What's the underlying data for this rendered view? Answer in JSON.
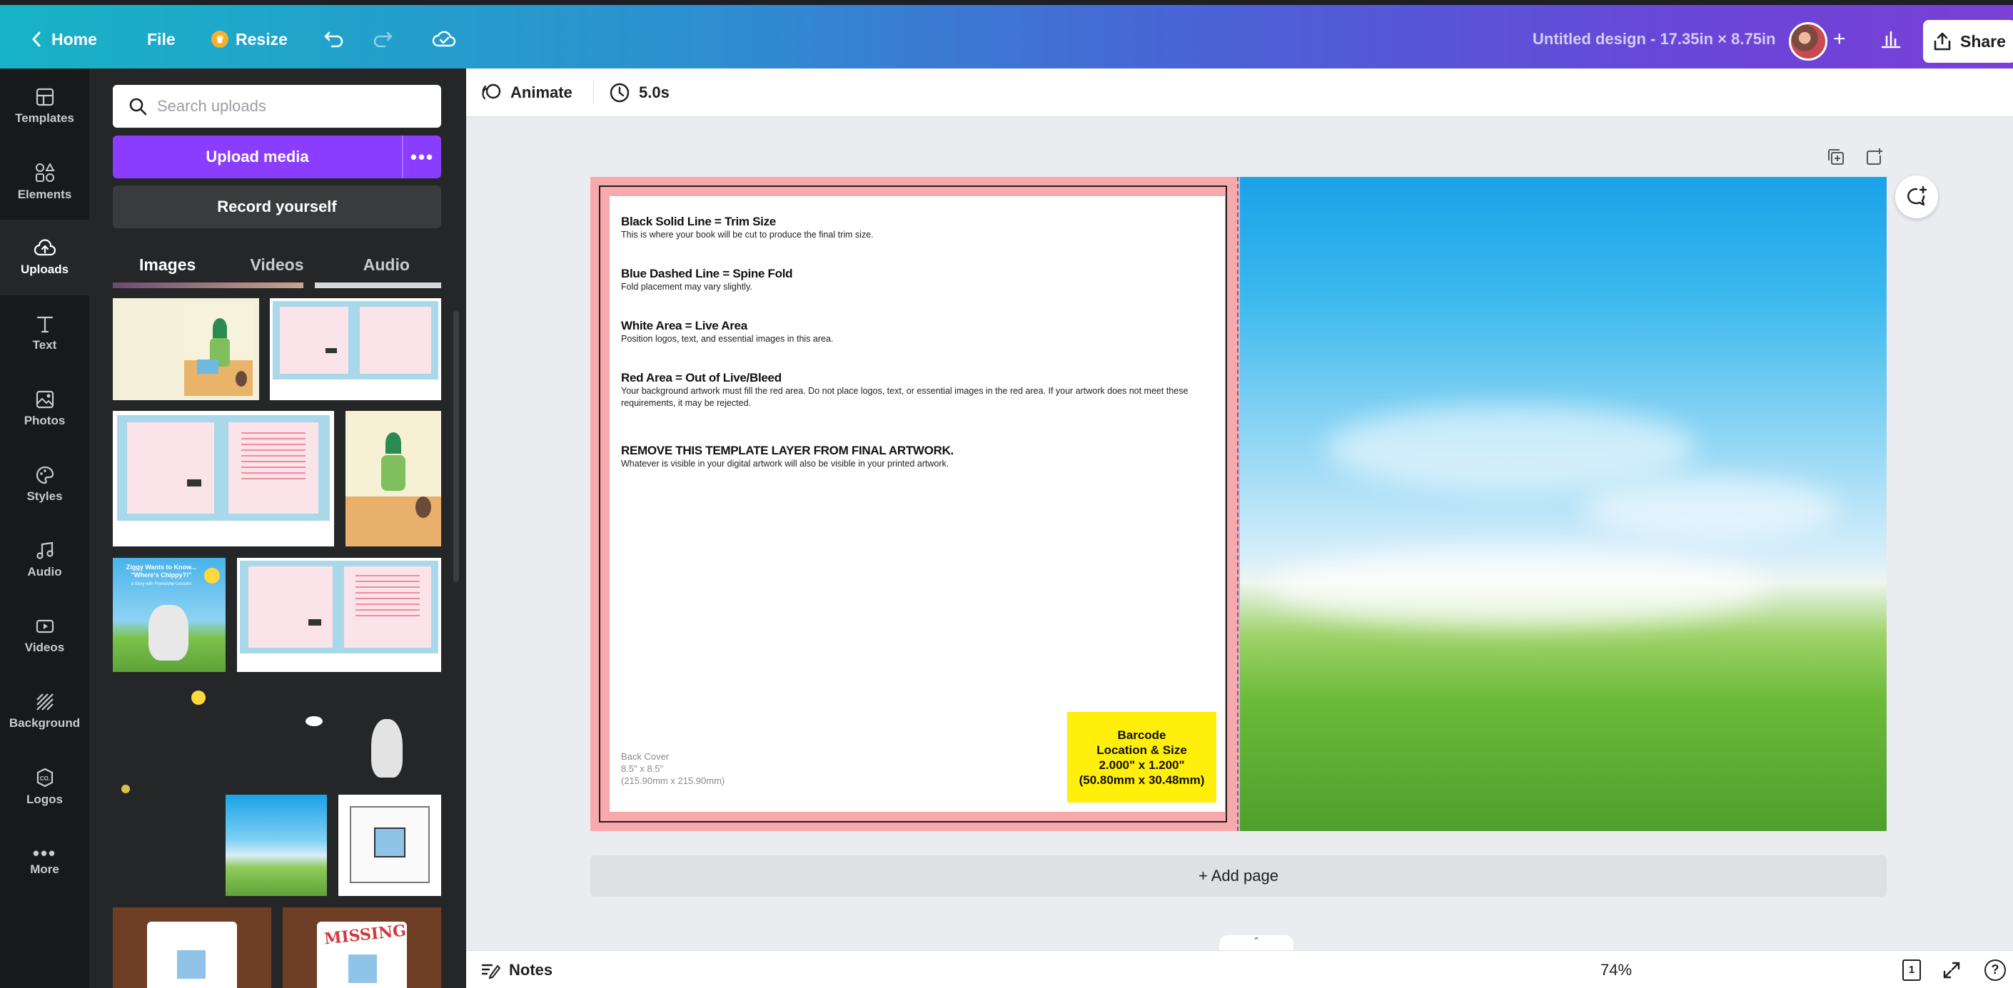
{
  "topbar": {
    "home_label": "Home",
    "file_label": "File",
    "resize_label": "Resize",
    "title": "Untitled design - 17.35in × 8.75in",
    "share_label": "Share"
  },
  "rail": {
    "items": [
      {
        "label": "Templates",
        "icon": "templates-icon"
      },
      {
        "label": "Elements",
        "icon": "elements-icon"
      },
      {
        "label": "Uploads",
        "icon": "uploads-icon"
      },
      {
        "label": "Text",
        "icon": "text-icon"
      },
      {
        "label": "Photos",
        "icon": "photos-icon"
      },
      {
        "label": "Styles",
        "icon": "styles-icon"
      },
      {
        "label": "Audio",
        "icon": "audio-icon"
      },
      {
        "label": "Videos",
        "icon": "videos-icon"
      },
      {
        "label": "Background",
        "icon": "background-icon"
      },
      {
        "label": "Logos",
        "icon": "logos-icon"
      },
      {
        "label": "More",
        "icon": "more-icon"
      }
    ],
    "active": "Uploads"
  },
  "panel": {
    "search_placeholder": "Search uploads",
    "upload_label": "Upload media",
    "record_label": "Record yourself",
    "tabs": [
      "Images",
      "Videos",
      "Audio"
    ],
    "active_tab": "Images",
    "thumb_texts": {
      "ziggy_title": "Ziggy Wants to Know... \"Where's Chippy?!\"",
      "ziggy_sub": "a Story with Friendship Lessons",
      "missing": "MISSING"
    }
  },
  "canvas": {
    "animate_label": "Animate",
    "duration_label": "5.0s",
    "template": {
      "h1": "Black Solid Line = Trim Size",
      "p1": "This is where your book will be cut to produce the final trim size.",
      "h2": "Blue Dashed Line = Spine Fold",
      "p2": "Fold placement may vary slightly.",
      "h3": "White Area = Live Area",
      "p3": "Position logos, text, and essential images in this area.",
      "h4": "Red Area = Out of Live/Bleed",
      "p4": "Your background artwork must fill the red area. Do not place logos, text, or essential images in the red area. If your artwork does not meet these requirements, it may be rejected.",
      "h5": "REMOVE THIS TEMPLATE LAYER FROM FINAL ARTWORK.",
      "p5": "Whatever is visible in your digital artwork will also be visible in your printed artwork.",
      "back_cover": "Back Cover",
      "back_size_in": "8.5\" x 8.5\"",
      "back_size_mm": "(215.90mm x 215.90mm)",
      "barcode_1": "Barcode",
      "barcode_2": "Location & Size",
      "barcode_3": "2.000\" x 1.200\"",
      "barcode_4": "(50.80mm x 30.48mm)"
    },
    "add_page_label": "+ Add page"
  },
  "bottombar": {
    "notes_label": "Notes",
    "zoom_label": "74%",
    "zoom_fraction": 0.1,
    "page_count": "1"
  },
  "colors": {
    "accent": "#8b3dff",
    "bleed": "#f7a9ab",
    "barcode_bg": "#ffef0a",
    "rail_bg": "#18191b",
    "panel_bg": "#252627"
  }
}
